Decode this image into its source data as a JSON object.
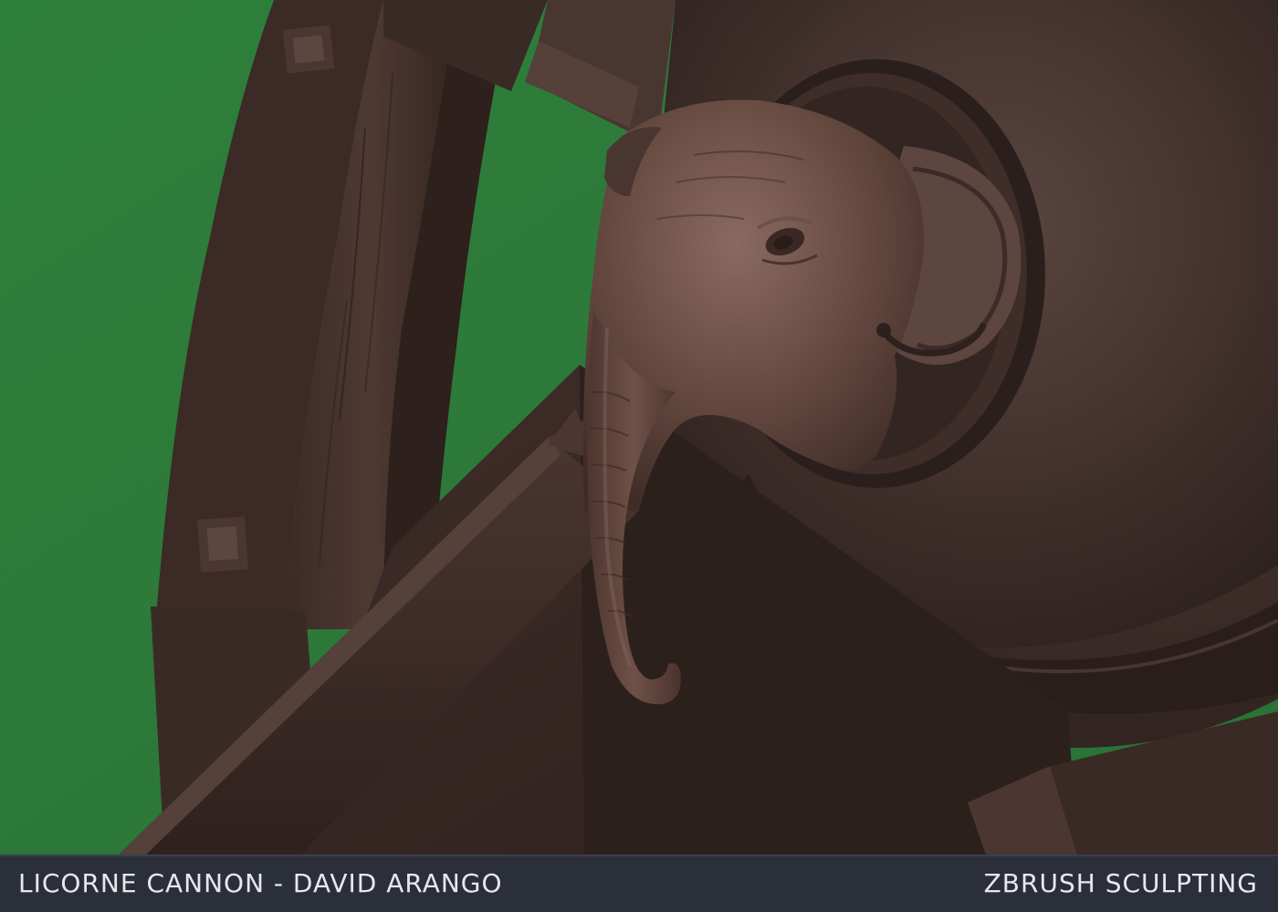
{
  "caption": {
    "left": "LICORNE CANNON - DAVID ARANGO",
    "right": "ZBRUSH SCULPTING"
  },
  "colors": {
    "background": "#2f7b3b",
    "clay": "#4a3631",
    "caption_bar": "#2b2f39",
    "caption_text": "#e8e8ec"
  }
}
